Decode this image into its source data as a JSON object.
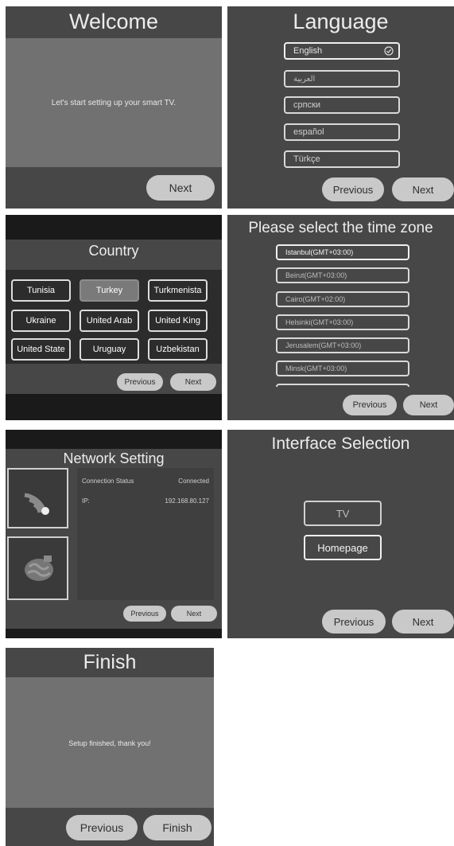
{
  "welcome": {
    "title": "Welcome",
    "message": "Let's start setting up your smart TV.",
    "next_label": "Next"
  },
  "language": {
    "title": "Language",
    "options": [
      "English",
      "العربية",
      "српски",
      "español",
      "Türkçe"
    ],
    "selected_index": 0,
    "previous_label": "Previous",
    "next_label": "Next"
  },
  "country": {
    "title": "Country",
    "options": [
      "Tunisia",
      "Turkey",
      "Turkmenista",
      "Ukraine",
      "United Arab",
      "United King",
      "United State",
      "Uruguay",
      "Uzbekistan"
    ],
    "selected_index": 1,
    "previous_label": "Previous",
    "next_label": "Next"
  },
  "timezone": {
    "title": "Please select the time zone",
    "options": [
      "Istanbul(GMT+03:00)",
      "Beirut(GMT+03:00)",
      "Cairo(GMT+02:00)",
      "Helsinki(GMT+03:00)",
      "Jerusalem(GMT+03:00)",
      "Minsk(GMT+03:00)"
    ],
    "selected_index": 0,
    "previous_label": "Previous",
    "next_label": "Next"
  },
  "network": {
    "title": "Network Setting",
    "status_label": "Connection Status",
    "status_value": "Connected",
    "ip_label": "IP:",
    "ip_value": "192.168.80.127",
    "wifi_icon": "wifi-icon",
    "ethernet_icon": "ethernet-icon",
    "previous_label": "Previous",
    "next_label": "Next"
  },
  "interface": {
    "title": "Interface Selection",
    "option_tv": "TV",
    "option_homepage": "Homepage",
    "previous_label": "Previous",
    "next_label": "Next"
  },
  "finish": {
    "title": "Finish",
    "message": "Setup finished, thank you!",
    "previous_label": "Previous",
    "finish_label": "Finish"
  },
  "colors": {
    "panel": "#474747",
    "panel_light": "#717171",
    "button": "#c9c9c9",
    "border": "#d9d9d9"
  }
}
